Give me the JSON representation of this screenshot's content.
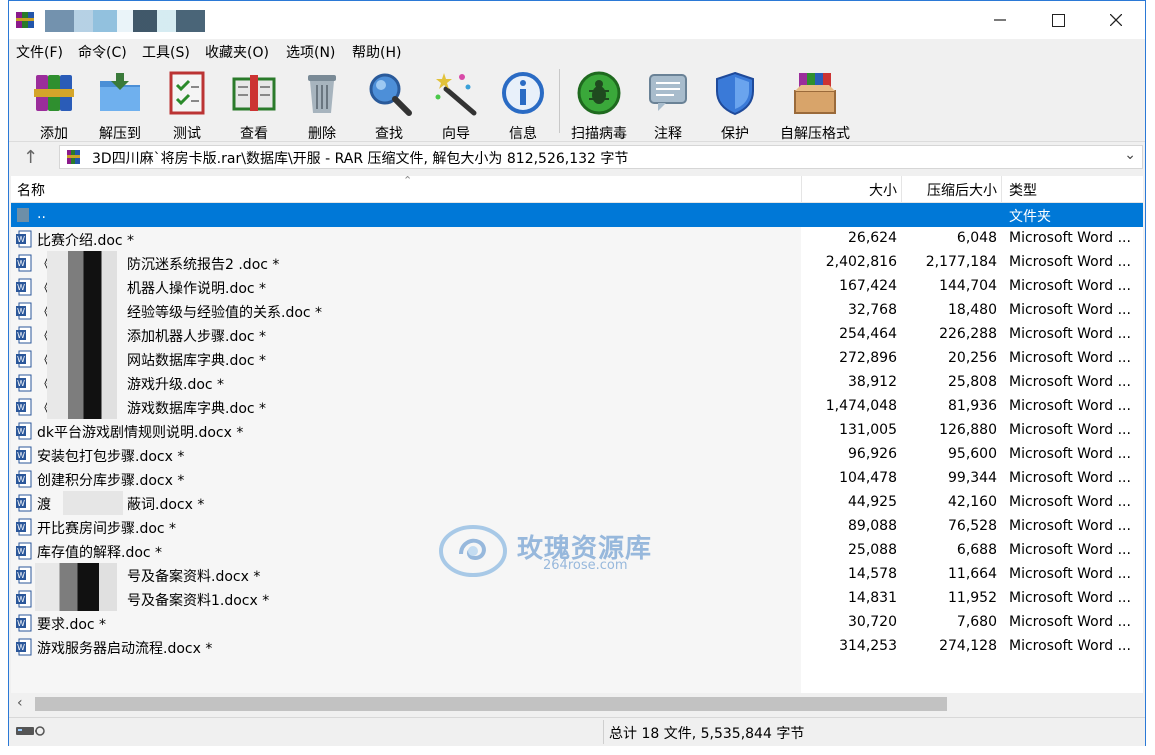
{
  "menu": [
    "文件(F)",
    "命令(C)",
    "工具(S)",
    "收藏夹(O)",
    "选项(N)",
    "帮助(H)"
  ],
  "toolbar": [
    "添加",
    "解压到",
    "测试",
    "查看",
    "删除",
    "查找",
    "向导",
    "信息",
    "扫描病毒",
    "注释",
    "保护",
    "自解压格式"
  ],
  "address": {
    "path": "3D四川麻`将房卡版.rar\\数据库\\开服 - RAR 压缩文件, 解包大小为 812,526,132 字节"
  },
  "columns": {
    "name": "名称",
    "size": "大小",
    "packed": "压缩后大小",
    "type": "类型"
  },
  "parent_row": {
    "name": "..",
    "type": "文件夹"
  },
  "files": [
    {
      "name": "比赛介绍.doc *",
      "size": "26,624",
      "packed": "6,048",
      "type": "Microsoft Word ..."
    },
    {
      "name": "《",
      "name2": "防沉迷系统报告2 .doc *",
      "size": "2,402,816",
      "packed": "2,177,184",
      "type": "Microsoft Word ..."
    },
    {
      "name": "《",
      "name2": "机器人操作说明.doc *",
      "size": "167,424",
      "packed": "144,704",
      "type": "Microsoft Word ..."
    },
    {
      "name": "《",
      "name2": "经验等级与经验值的关系.doc *",
      "size": "32,768",
      "packed": "18,480",
      "type": "Microsoft Word ..."
    },
    {
      "name": "《",
      "name2": "添加机器人步骤.doc *",
      "size": "254,464",
      "packed": "226,288",
      "type": "Microsoft Word ..."
    },
    {
      "name": "《",
      "name2": "网站数据库字典.doc *",
      "size": "272,896",
      "packed": "20,256",
      "type": "Microsoft Word ..."
    },
    {
      "name": "《",
      "name2": "游戏升级.doc *",
      "size": "38,912",
      "packed": "25,808",
      "type": "Microsoft Word ..."
    },
    {
      "name": "《",
      "name2": "游戏数据库字典.doc *",
      "size": "1,474,048",
      "packed": "81,936",
      "type": "Microsoft Word ..."
    },
    {
      "name": "dk平台游戏剧情规则说明.docx *",
      "size": "131,005",
      "packed": "126,880",
      "type": "Microsoft Word ..."
    },
    {
      "name": "安装包打包步骤.docx *",
      "size": "96,926",
      "packed": "95,600",
      "type": "Microsoft Word ..."
    },
    {
      "name": "创建积分库步骤.docx *",
      "size": "104,478",
      "packed": "99,344",
      "type": "Microsoft Word ..."
    },
    {
      "name": "渡",
      "name2": "蔽词.docx *",
      "size": "44,925",
      "packed": "42,160",
      "type": "Microsoft Word ..."
    },
    {
      "name": "开比赛房间步骤.doc *",
      "size": "89,088",
      "packed": "76,528",
      "type": "Microsoft Word ..."
    },
    {
      "name": "库存值的解释.doc *",
      "size": "25,088",
      "packed": "6,688",
      "type": "Microsoft Word ..."
    },
    {
      "name": "",
      "name2": "号及备案资料.docx *",
      "size": "14,578",
      "packed": "11,664",
      "type": "Microsoft Word ..."
    },
    {
      "name": "",
      "name2": "号及备案资料1.docx *",
      "size": "14,831",
      "packed": "11,952",
      "type": "Microsoft Word ..."
    },
    {
      "name": "要求.doc *",
      "size": "30,720",
      "packed": "7,680",
      "type": "Microsoft Word ..."
    },
    {
      "name": "游戏服务器启动流程.docx *",
      "size": "314,253",
      "packed": "274,128",
      "type": "Microsoft Word ..."
    }
  ],
  "watermark": {
    "cn": "玫瑰资源库",
    "en": "264rose.com"
  },
  "status": {
    "text": "总计 18 文件, 5,535,844 字节"
  },
  "colors": {
    "selection": "#0078d7",
    "accent": "#2b79d6"
  }
}
